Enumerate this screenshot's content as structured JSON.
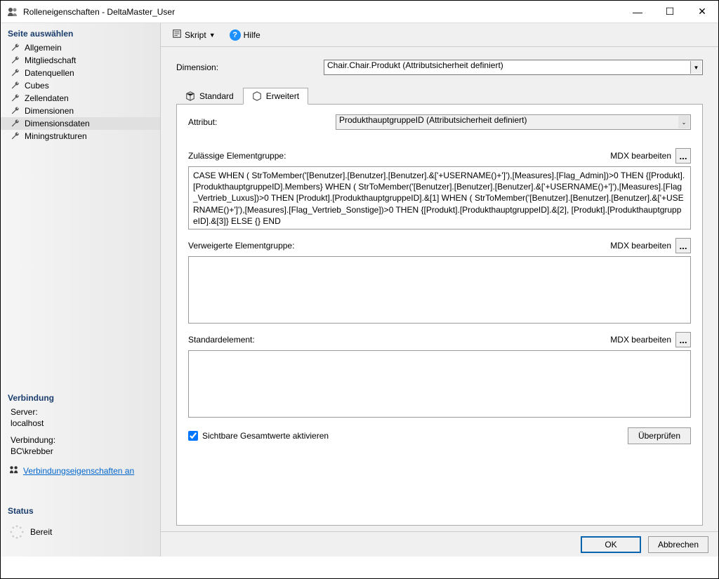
{
  "window": {
    "title": "Rolleneigenschaften - DeltaMaster_User",
    "minimize": "—",
    "maximize": "☐",
    "close": "✕"
  },
  "sidebar": {
    "heading_pages": "Seite auswählen",
    "items": [
      {
        "label": "Allgemein"
      },
      {
        "label": "Mitgliedschaft"
      },
      {
        "label": "Datenquellen"
      },
      {
        "label": "Cubes"
      },
      {
        "label": "Zellendaten"
      },
      {
        "label": "Dimensionen"
      },
      {
        "label": "Dimensionsdaten"
      },
      {
        "label": "Miningstrukturen"
      }
    ],
    "heading_connection": "Verbindung",
    "server_label": "Server:",
    "server_value": "localhost",
    "conn_label": "Verbindung:",
    "conn_value": "BC\\krebber",
    "view_conn_link": "Verbindungseigenschaften an",
    "heading_status": "Status",
    "status_value": "Bereit"
  },
  "toolbar": {
    "script_label": "Skript",
    "help_label": "Hilfe"
  },
  "content": {
    "dimension_label": "Dimension:",
    "dimension_value": "Chair.Chair.Produkt (Attributsicherheit definiert)",
    "tab_standard": "Standard",
    "tab_erweitert": "Erweitert",
    "attribut_label": "Attribut:",
    "attribut_value": "ProdukthauptgruppeID (Attributsicherheit definiert)",
    "allowed_label": "Zulässige Elementgruppe:",
    "mdx_edit": "MDX bearbeiten",
    "allowed_mdx": "CASE WHEN  ( StrToMember('[Benutzer].[Benutzer].[Benutzer].&['+USERNAME()+']'),[Measures].[Flag_Admin])>0 THEN {[Produkt].[ProdukthauptgruppeID].Members} WHEN  ( StrToMember('[Benutzer].[Benutzer].[Benutzer].&['+USERNAME()+']'),[Measures].[Flag_Vertrieb_Luxus])>0 THEN [Produkt].[ProdukthauptgruppeID].&[1] WHEN  ( StrToMember('[Benutzer].[Benutzer].[Benutzer].&['+USERNAME()+']'),[Measures].[Flag_Vertrieb_Sonstige])>0 THEN {[Produkt].[ProdukthauptgruppeID].&[2], [Produkt].[ProdukthauptgruppeID].&[3]} ELSE {} END",
    "denied_label": "Verweigerte Elementgruppe:",
    "denied_mdx": "",
    "default_label": "Standardelement:",
    "default_mdx": "",
    "visible_totals": "Sichtbare Gesamtwerte aktivieren",
    "verify_btn": "Überprüfen"
  },
  "footer": {
    "ok": "OK",
    "cancel": "Abbrechen"
  }
}
